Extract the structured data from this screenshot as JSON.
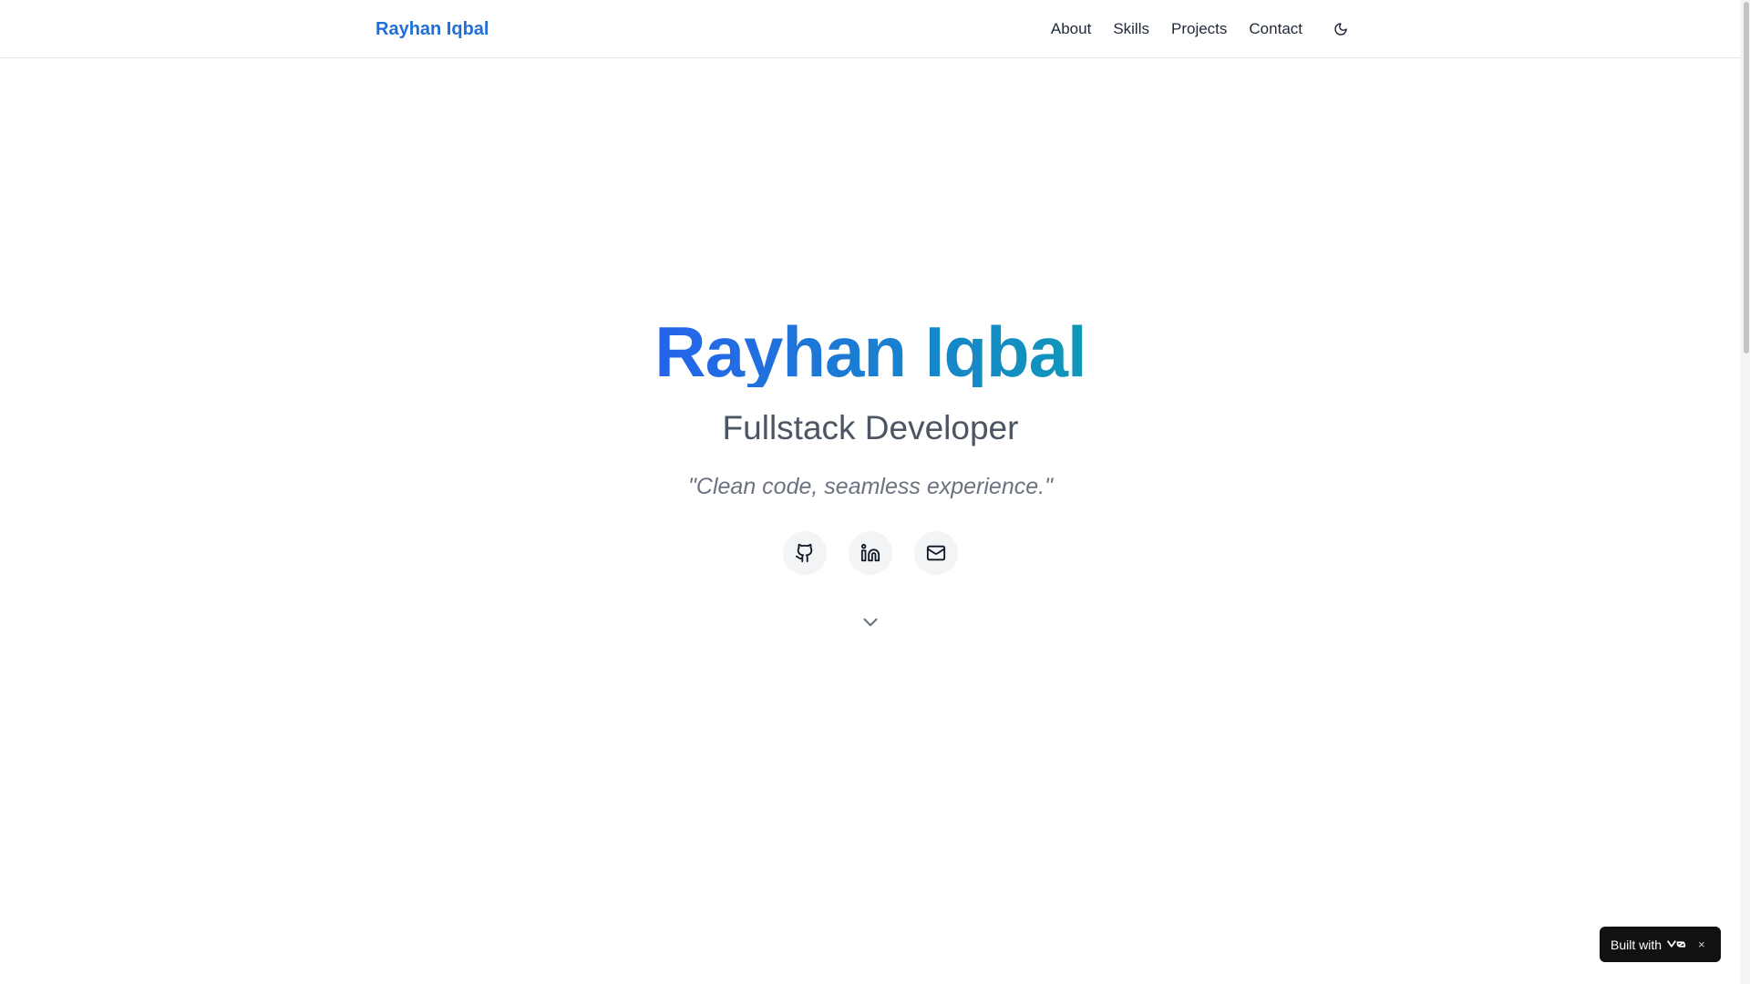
{
  "header": {
    "brand": "Rayhan Iqbal",
    "nav": [
      {
        "label": "About"
      },
      {
        "label": "Skills"
      },
      {
        "label": "Projects"
      },
      {
        "label": "Contact"
      }
    ],
    "theme_toggle_icon": "moon-icon"
  },
  "hero": {
    "name": "Rayhan Iqbal",
    "role": "Fullstack Developer",
    "quote": "\"Clean code, seamless experience.\"",
    "socials": [
      {
        "icon": "github-icon"
      },
      {
        "icon": "linkedin-icon"
      },
      {
        "icon": "mail-icon"
      }
    ],
    "scroll_icon": "chevron-down-icon"
  },
  "badge": {
    "label": "Built with",
    "logo_icon": "v0-logo-icon",
    "close": "×"
  },
  "colors": {
    "brand": "#1f6fd6",
    "gradient_start": "#2563eb",
    "gradient_end": "#0f98b8",
    "role_text": "#4b5563",
    "quote_text": "#6b7280",
    "social_bg": "#f3f4f6",
    "badge_bg": "#111111"
  }
}
